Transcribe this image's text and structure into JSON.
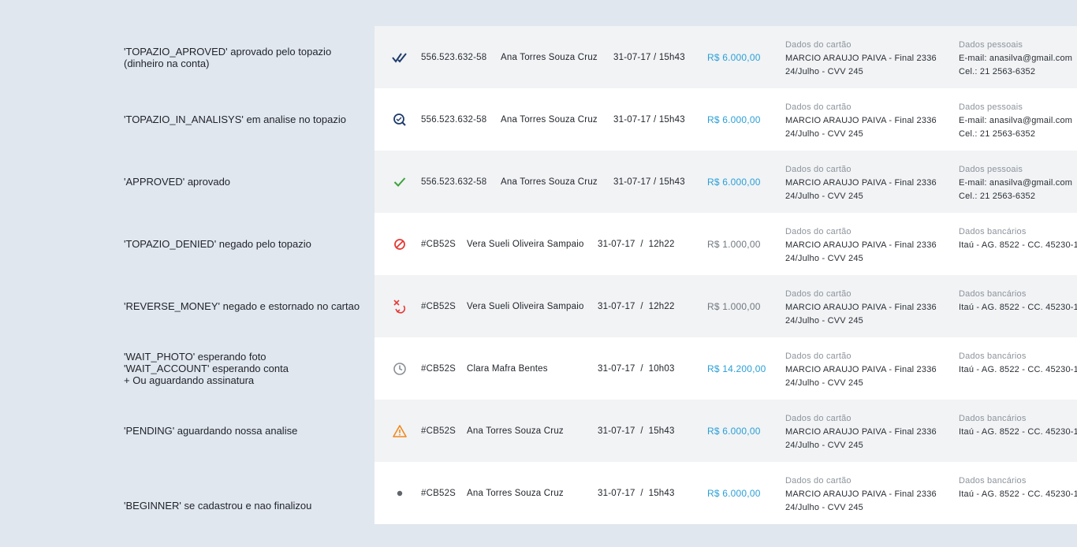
{
  "rows": [
    {
      "status_label": "'TOPAZIO_APROVED' aprovado pelo topazio\n(dinheiro na conta)",
      "icon": "double-check-icon",
      "id": "556.523.632-58",
      "name": "Ana Torres Souza Cruz",
      "date": "31-07-17 / 15h43",
      "amount": "R$ 6.000,00",
      "amount_color": "#2a9fd6",
      "card_header": "Dados do cartão",
      "card_line1": "MARCIO ARAUJO PAIVA - Final 2336",
      "card_line2": "24/Julho - CVV 245",
      "extra_header": "Dados pessoais",
      "extra_line1": "E-mail: anasilva@gmail.com",
      "extra_line2": "Cel.: 21 2563-6352"
    },
    {
      "status_label": "'TOPAZIO_IN_ANALISYS' em analise no topazio",
      "icon": "search-analysis-icon",
      "id": "556.523.632-58",
      "name": "Ana Torres Souza Cruz",
      "date": "31-07-17 / 15h43",
      "amount": "R$ 6.000,00",
      "amount_color": "#2a9fd6",
      "card_header": "Dados do cartão",
      "card_line1": "MARCIO ARAUJO PAIVA - Final 2336",
      "card_line2": "24/Julho - CVV 245",
      "extra_header": "Dados pessoais",
      "extra_line1": "E-mail: anasilva@gmail.com",
      "extra_line2": "Cel.: 21 2563-6352"
    },
    {
      "status_label": "'APPROVED' aprovado",
      "icon": "check-icon",
      "id": "556.523.632-58",
      "name": "Ana Torres Souza Cruz",
      "date": "31-07-17 / 15h43",
      "amount": "R$ 6.000,00",
      "amount_color": "#2a9fd6",
      "card_header": "Dados do cartão",
      "card_line1": "MARCIO ARAUJO PAIVA - Final 2336",
      "card_line2": "24/Julho - CVV 245",
      "extra_header": "Dados pessoais",
      "extra_line1": "E-mail: anasilva@gmail.com",
      "extra_line2": "Cel.: 21 2563-6352"
    },
    {
      "status_label": "'TOPAZIO_DENIED' negado pelo topazio",
      "icon": "denied-icon",
      "id": "#CB52S",
      "name": "Vera Sueli Oliveira Sampaio",
      "date": "31-07-17  /  12h22",
      "amount": "R$ 1.000,00",
      "amount_color": "#707880",
      "card_header": "Dados do cartão",
      "card_line1": "MARCIO ARAUJO PAIVA - Final 2336",
      "card_line2": "24/Julho - CVV 245",
      "extra_header": "Dados bancários",
      "extra_line1": "Itaú - AG. 8522 - CC. 45230-1",
      "extra_line2": ""
    },
    {
      "status_label": "'REVERSE_MONEY' negado e estornado no cartao",
      "icon": "reverse-icon",
      "id": "#CB52S",
      "name": "Vera Sueli Oliveira Sampaio",
      "date": "31-07-17  /  12h22",
      "amount": "R$ 1.000,00",
      "amount_color": "#707880",
      "card_header": "Dados do cartão",
      "card_line1": "MARCIO ARAUJO PAIVA - Final 2336",
      "card_line2": "24/Julho - CVV 245",
      "extra_header": "Dados bancários",
      "extra_line1": "Itaú - AG. 8522 - CC. 45230-1",
      "extra_line2": ""
    },
    {
      "status_label": "'WAIT_PHOTO' esperando foto\n'WAIT_ACCOUNT' esperando conta\n+ Ou aguardando assinatura",
      "icon": "clock-icon",
      "id": "#CB52S",
      "name": "Clara Mafra Bentes",
      "date": "31-07-17  /  10h03",
      "amount": "R$ 14.200,00",
      "amount_color": "#2a9fd6",
      "card_header": "Dados do cartão",
      "card_line1": "MARCIO ARAUJO PAIVA - Final 2336",
      "card_line2": "24/Julho - CVV 245",
      "extra_header": "Dados bancários",
      "extra_line1": "Itaú - AG. 8522 - CC. 45230-1",
      "extra_line2": ""
    },
    {
      "status_label": "'PENDING' aguardando nossa analise",
      "icon": "warning-icon",
      "id": "#CB52S",
      "name": "Ana Torres Souza Cruz",
      "date": "31-07-17  /  15h43",
      "amount": "R$ 6.000,00",
      "amount_color": "#2a9fd6",
      "card_header": "Dados do cartão",
      "card_line1": "MARCIO ARAUJO PAIVA - Final 2336",
      "card_line2": "24/Julho - CVV 245",
      "extra_header": "Dados bancários",
      "extra_line1": "Itaú - AG. 8522 - CC. 45230-1",
      "extra_line2": ""
    },
    {
      "status_label": "'BEGINNER' se cadastrou e nao finalizou",
      "icon": "dot-icon",
      "id": "#CB52S",
      "name": "Ana Torres Souza Cruz",
      "date": "31-07-17  /  15h43",
      "amount": "R$ 6.000,00",
      "amount_color": "#2a9fd6",
      "card_header": "Dados do cartão",
      "card_line1": "MARCIO ARAUJO PAIVA - Final 2336",
      "card_line2": "24/Julho - CVV 245",
      "extra_header": "Dados bancários",
      "extra_line1": "Itaú - AG. 8522 - CC. 45230-1",
      "extra_line2": ""
    }
  ]
}
